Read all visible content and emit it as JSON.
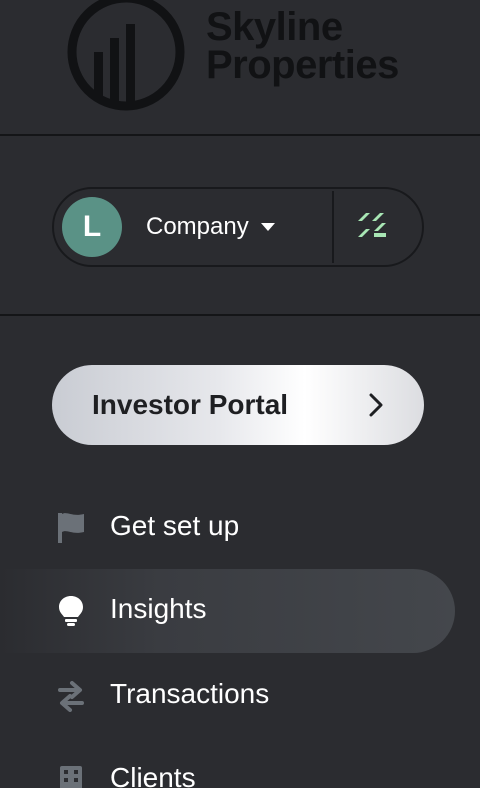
{
  "brand": {
    "line1": "Skyline",
    "line2": "Properties"
  },
  "account": {
    "avatar_letter": "L",
    "company_label": "Company"
  },
  "portal": {
    "label": "Investor Portal"
  },
  "nav": {
    "items": [
      {
        "label": "Get set up",
        "icon": "flag-icon"
      },
      {
        "label": "Insights",
        "icon": "lightbulb-icon",
        "active": true
      },
      {
        "label": "Transactions",
        "icon": "arrows-exchange-icon"
      },
      {
        "label": "Clients",
        "icon": "building-icon"
      }
    ]
  },
  "colors": {
    "background": "#2b2c30",
    "avatar": "#5a9286",
    "accent_green": "#a8e6b4",
    "icon_muted": "#6b7178",
    "active_bg": "#44474c"
  }
}
